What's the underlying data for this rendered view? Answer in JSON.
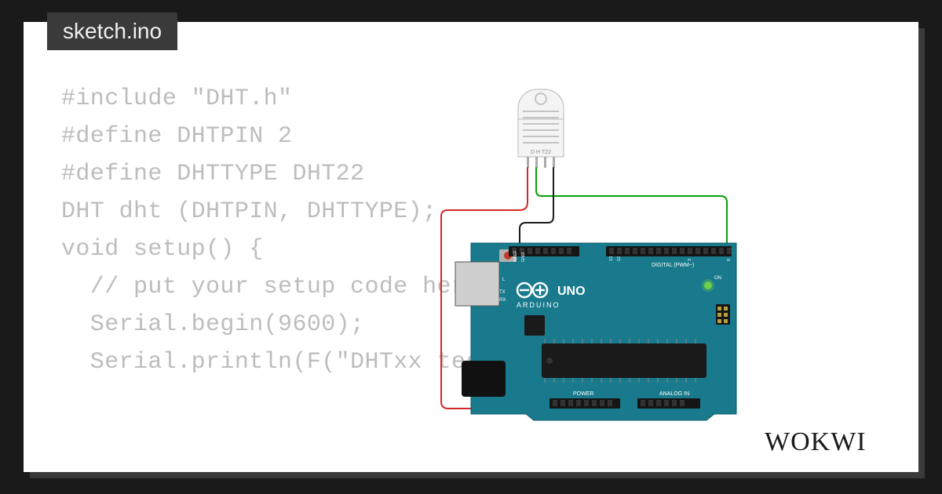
{
  "tab": {
    "filename": "sketch.ino"
  },
  "code": {
    "lines": [
      "#include \"DHT.h\"",
      "#define DHTPIN 2",
      "#define DHTTYPE DHT22",
      "",
      "DHT dht (DHTPIN, DHTTYPE);",
      "",
      "void setup() {",
      "  // put your setup code here, to run once:",
      "  Serial.begin(9600);",
      "  Serial.println(F(\"DHTxx test!\"));"
    ]
  },
  "logo": {
    "text": "WOKWI"
  },
  "board": {
    "name": "UNO",
    "brand": "ARDUINO",
    "sensor_label": "D H T22",
    "digital_label": "DIGITAL (PWM~)",
    "analog_label": "ANALOG IN",
    "power_label": "POWER",
    "on_label": "ON",
    "tx_label": "TX",
    "rx_label": "RX",
    "l_label": "L",
    "colors": {
      "board": "#1f7a8c",
      "board_dark": "#0d5c6e",
      "wire_red": "#d62828",
      "wire_green": "#0aa00a",
      "wire_black": "#1a1a1a",
      "sensor_body": "#e8e8e8",
      "led_on": "#6fcf4a"
    }
  }
}
